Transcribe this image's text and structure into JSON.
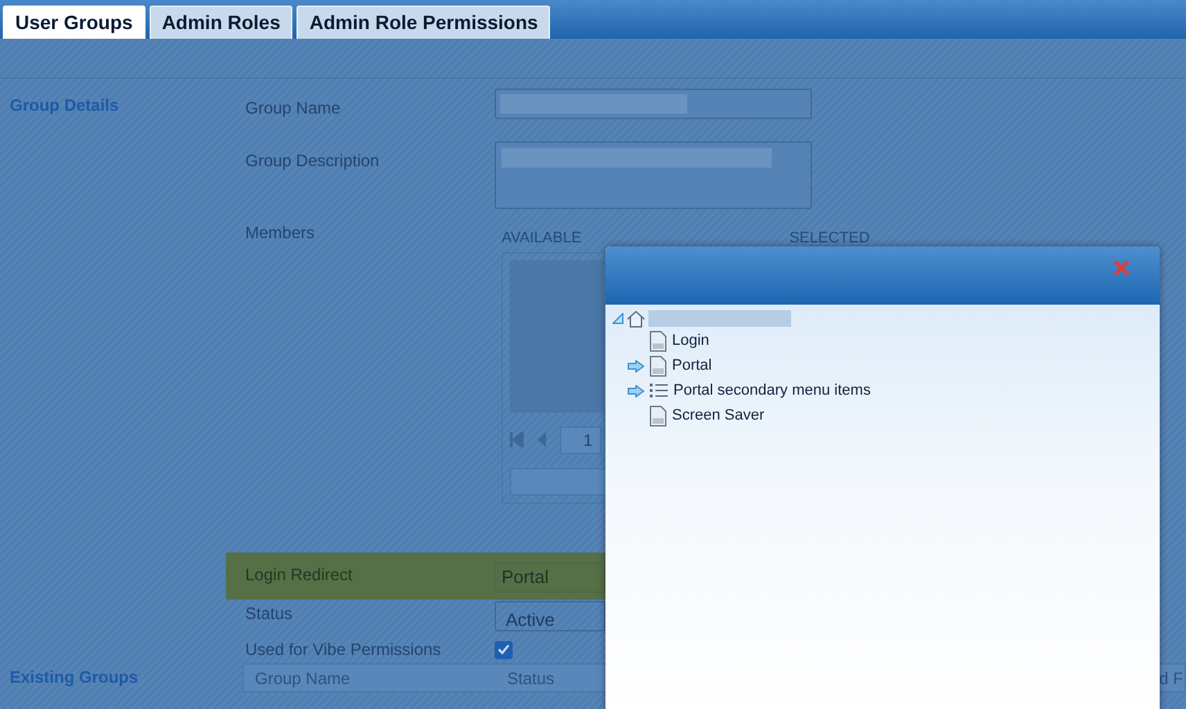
{
  "tabs": [
    {
      "label": "User Groups",
      "selected": true
    },
    {
      "label": "Admin Roles",
      "selected": false
    },
    {
      "label": "Admin Role Permissions",
      "selected": false
    }
  ],
  "group_details": {
    "heading": "Group Details",
    "group_name_label": "Group Name",
    "group_description_label": "Group Description",
    "members_label": "Members",
    "available_label": "AVAILABLE",
    "selected_label": "SELECTED",
    "page_number": "1",
    "login_redirect": {
      "label": "Login Redirect",
      "value": "Portal"
    },
    "status": {
      "label": "Status",
      "value": "Active"
    },
    "vibe_permissions": {
      "label": "Used for Vibe Permissions",
      "checked": true
    }
  },
  "existing_groups": {
    "heading": "Existing Groups",
    "columns": [
      "Group Name",
      "Status",
      "d F"
    ]
  },
  "dialog": {
    "tree": {
      "expanded": true,
      "children": [
        {
          "label": "Login",
          "kind": "page",
          "current": false
        },
        {
          "label": "Portal",
          "kind": "page",
          "current": true
        },
        {
          "label": "Portal secondary menu items",
          "kind": "list",
          "current": true
        },
        {
          "label": "Screen Saver",
          "kind": "page",
          "current": false
        }
      ]
    }
  }
}
